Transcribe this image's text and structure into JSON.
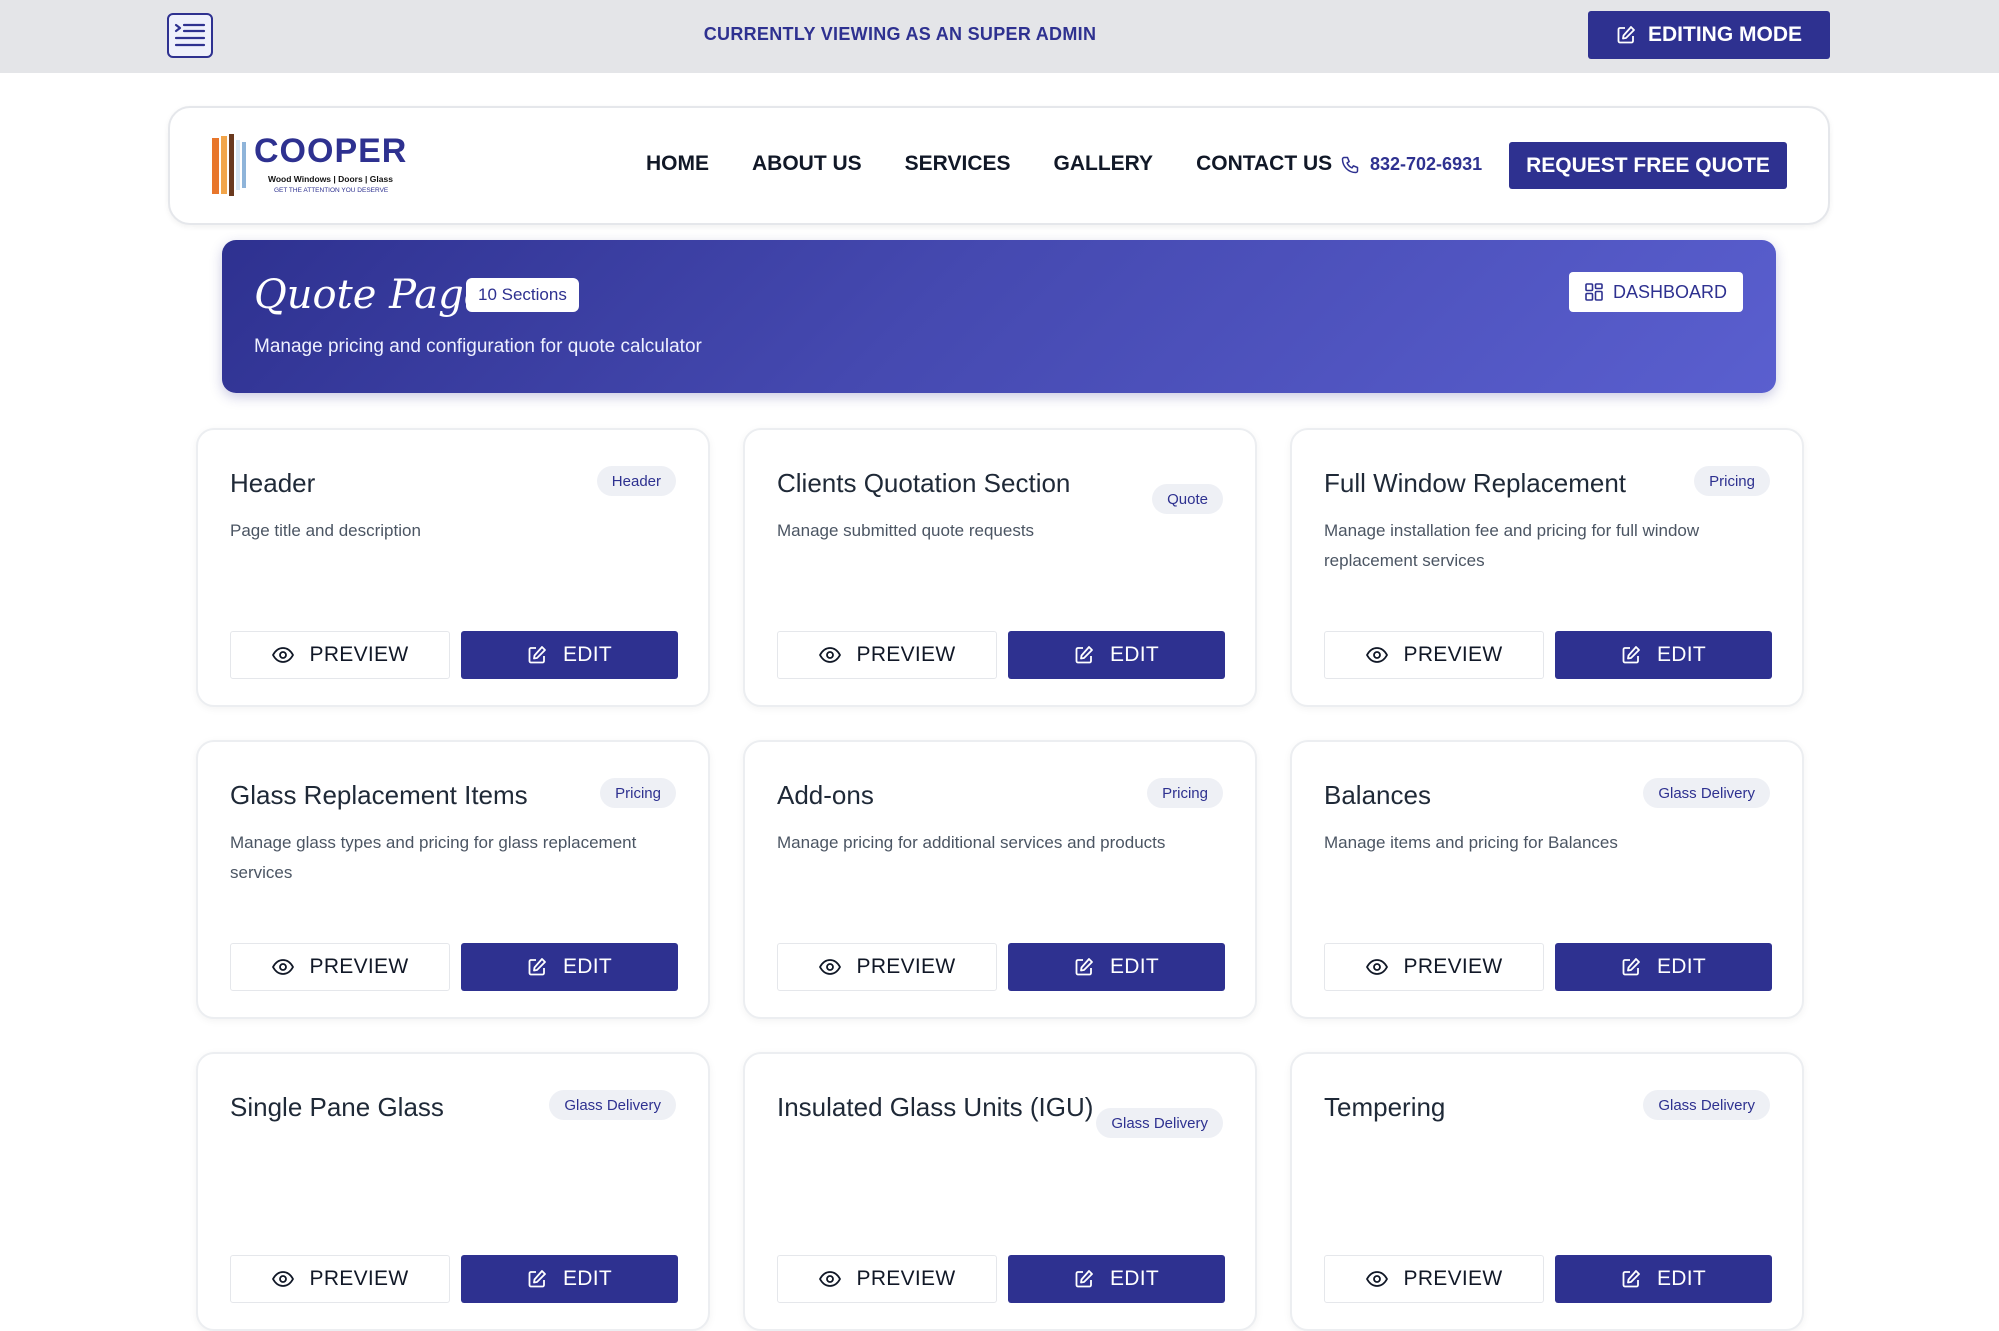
{
  "colors": {
    "primary": "#2e3190",
    "admin_bar": "#e4e5e8",
    "tag_bg": "#eef0f5"
  },
  "admin_bar": {
    "menu_icon": "menu-list-icon",
    "label": "CURRENTLY VIEWING AS AN SUPER ADMIN",
    "editing_label": "EDITING MODE",
    "editing_icon": "edit-icon"
  },
  "nav": {
    "logo": {
      "brand": "COOPER",
      "tagline": "Wood Windows | Doors | Glass",
      "slogan": "GET THE ATTENTION YOU DESERVE"
    },
    "links": [
      "HOME",
      "ABOUT US",
      "SERVICES",
      "GALLERY",
      "CONTACT US"
    ],
    "phone": "832-702-6931",
    "phone_icon": "phone-icon",
    "cta": "REQUEST FREE QUOTE"
  },
  "hero": {
    "title": "Quote Page",
    "badge": "10 Sections",
    "subtitle": "Manage pricing and configuration for quote calculator",
    "dashboard_label": "DASHBOARD",
    "dashboard_icon": "grid-icon"
  },
  "labels": {
    "preview": "PREVIEW",
    "edit": "EDIT"
  },
  "cards": [
    {
      "title": "Header",
      "tag": "Header",
      "desc": "Page title and description"
    },
    {
      "title": "Clients Quotation Section",
      "tag": "Quote",
      "desc": "Manage submitted quote requests"
    },
    {
      "title": "Full Window Replacement",
      "tag": "Pricing",
      "desc": "Manage installation fee and pricing for full window replacement services"
    },
    {
      "title": "Glass Replacement Items",
      "tag": "Pricing",
      "desc": "Manage glass types and pricing for glass replacement services"
    },
    {
      "title": "Add-ons",
      "tag": "Pricing",
      "desc": "Manage pricing for additional services and products"
    },
    {
      "title": "Balances",
      "tag": "Glass Delivery",
      "desc": "Manage items and pricing for Balances"
    },
    {
      "title": "Single Pane Glass",
      "tag": "Glass Delivery",
      "desc": ""
    },
    {
      "title": "Insulated Glass Units (IGU)",
      "tag": "Glass Delivery",
      "desc": ""
    },
    {
      "title": "Tempering",
      "tag": "Glass Delivery",
      "desc": ""
    }
  ]
}
